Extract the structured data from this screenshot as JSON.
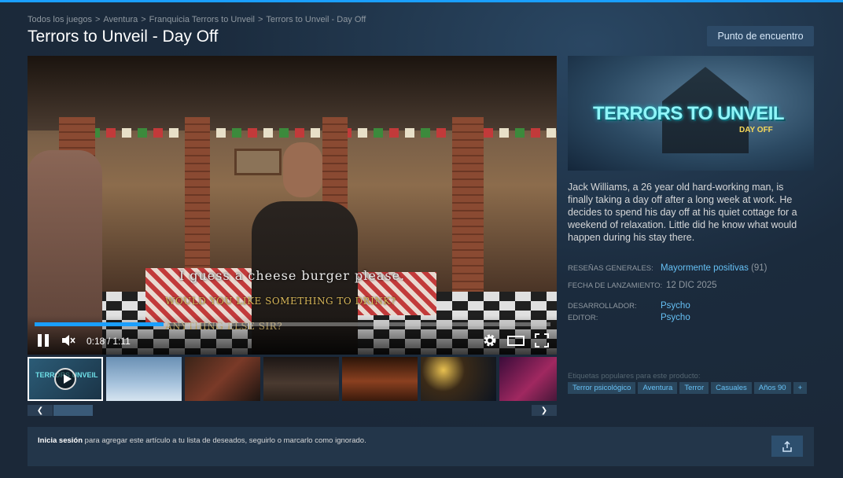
{
  "breadcrumb": [
    "Todos los juegos",
    "Aventura",
    "Franquicia Terrors to Unveil",
    "Terrors to Unveil - Day Off"
  ],
  "page_title": "Terrors to Unveil - Day Off",
  "hub_button": "Punto de encuentro",
  "player": {
    "subtitle": "I guess a cheese burger please.",
    "dialog_option_1": "WOULD YOU LIKE SOMETHING TO DRINK?",
    "dialog_option_2": "ANYTHING ELSE SIR?",
    "time": "0:18 / 1:11",
    "progress": 0.25,
    "state": "playing"
  },
  "thumbnails": {
    "count": 7,
    "selected_index": 0,
    "first_label": "TERRORS UNVEIL"
  },
  "capsule": {
    "logo": "TERRORS TO UNVEIL",
    "sub": "DAY OFF"
  },
  "description": "Jack Williams, a 26 year old hard-working man, is finally taking a day off after a long week at work. He decides to spend his day off at his quiet cottage for a weekend of relaxation. Little did he know what would happen during his stay there.",
  "info": {
    "reviews_label": "RESEÑAS GENERALES:",
    "reviews_value": "Mayormente positivas",
    "reviews_count": "(91)",
    "release_label": "FECHA DE LANZAMIENTO:",
    "release_value": "12 DIC 2025",
    "developer_label": "DESARROLLADOR:",
    "developer_value": "Psycho",
    "publisher_label": "EDITOR:",
    "publisher_value": "Psycho"
  },
  "tags_title": "Etiquetas populares para este producto:",
  "tags": [
    "Terror psicológico",
    "Aventura",
    "Terror",
    "Casuales",
    "Años 90",
    "+"
  ],
  "bottom": {
    "signin": "Inicia sesión",
    "rest": " para agregar este artículo a tu lista de deseados, seguirlo o marcarlo como ignorado."
  },
  "colors": {
    "accent": "#1a9fff",
    "link": "#66c0f4",
    "background": "#1b2838"
  }
}
